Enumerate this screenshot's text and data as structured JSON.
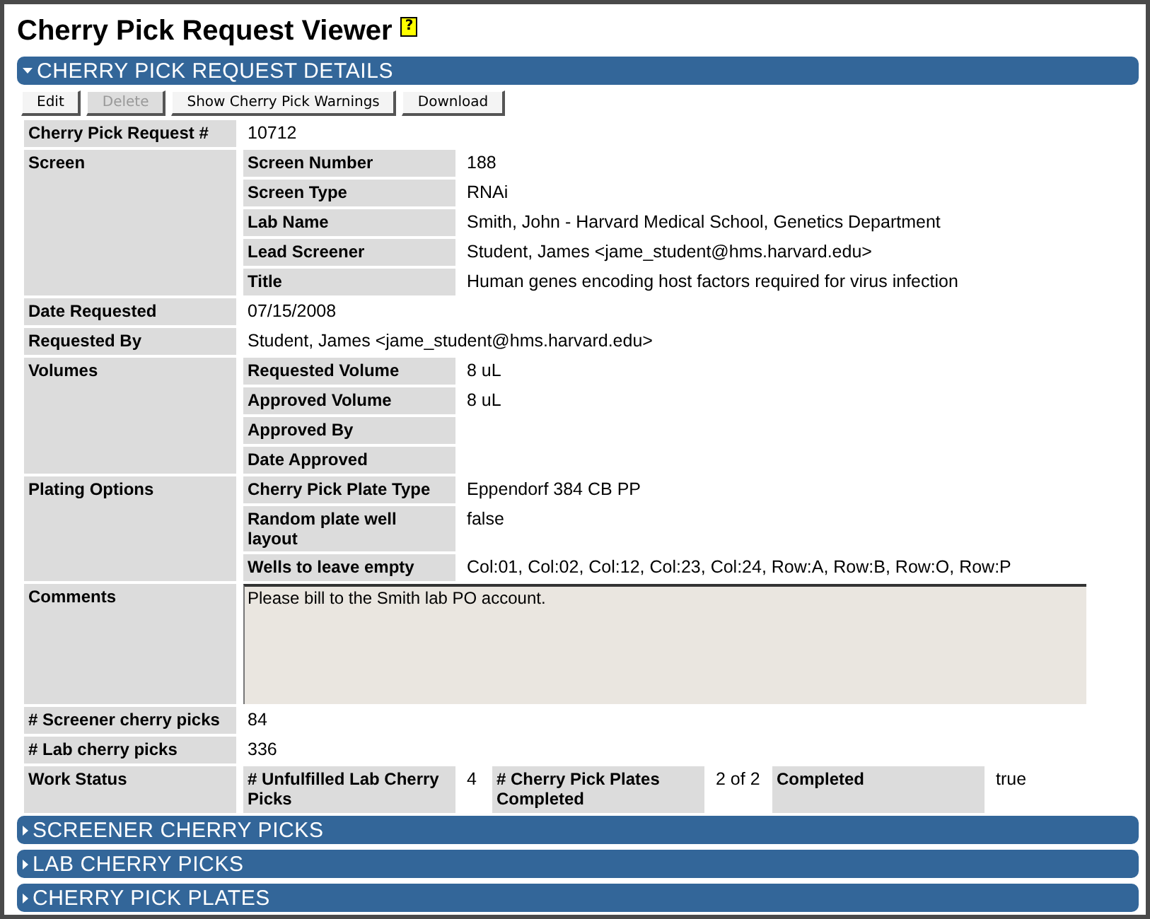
{
  "page": {
    "title": "Cherry Pick Request Viewer",
    "help_icon": "?"
  },
  "sections": [
    {
      "title": "CHERRY PICK REQUEST DETAILS",
      "expanded": true
    },
    {
      "title": "SCREENER CHERRY PICKS",
      "expanded": false
    },
    {
      "title": "LAB CHERRY PICKS",
      "expanded": false
    },
    {
      "title": "CHERRY PICK PLATES",
      "expanded": false
    }
  ],
  "buttons": [
    {
      "label": "Edit",
      "disabled": false
    },
    {
      "label": "Delete",
      "disabled": true
    },
    {
      "label": "Show Cherry Pick Warnings",
      "disabled": false
    },
    {
      "label": "Download",
      "disabled": false
    }
  ],
  "rows": [
    {
      "kind": "text",
      "label": "Cherry Pick Request #",
      "value": "10712"
    },
    {
      "kind": "group",
      "label": "Screen",
      "fields": [
        {
          "label": "Screen Number",
          "value": "188"
        },
        {
          "label": "Screen Type",
          "value": "RNAi"
        },
        {
          "label": "Lab Name",
          "value": "Smith, John - Harvard Medical School, Genetics Department"
        },
        {
          "label": "Lead Screener",
          "value": "Student, James <jame_student@hms.harvard.edu>"
        },
        {
          "label": "Title",
          "value": "Human genes encoding host factors required for virus infection"
        }
      ]
    },
    {
      "kind": "text",
      "label": "Date Requested",
      "value": "07/15/2008"
    },
    {
      "kind": "text",
      "label": "Requested By",
      "value": "Student, James <jame_student@hms.harvard.edu>"
    },
    {
      "kind": "group",
      "label": "Volumes",
      "fields": [
        {
          "label": "Requested Volume",
          "value": "8 uL"
        },
        {
          "label": "Approved Volume",
          "value": "8 uL"
        },
        {
          "label": "Approved By"
        },
        {
          "label": "Date Approved"
        }
      ]
    },
    {
      "kind": "group",
      "label": "Plating Options",
      "fields": [
        {
          "label": "Cherry Pick Plate Type",
          "value": "Eppendorf 384 CB PP"
        },
        {
          "label": "Random plate well layout",
          "value": "false"
        },
        {
          "label": "Wells to leave empty",
          "value": "Col:01, Col:02, Col:12, Col:23, Col:24, Row:A, Row:B, Row:O, Row:P"
        }
      ]
    },
    {
      "kind": "comments",
      "label": "Comments",
      "value": "Please bill to the Smith lab PO account."
    },
    {
      "kind": "text",
      "label": "# Screener cherry picks",
      "value": "84"
    },
    {
      "kind": "text",
      "label": "# Lab cherry picks",
      "value": "336"
    },
    {
      "kind": "inline",
      "label": "Work Status",
      "fields": [
        {
          "label": "# Unfulfilled Lab Cherry Picks",
          "value": "4"
        },
        {
          "label": "# Cherry Pick Plates Completed",
          "value": "2 of 2"
        },
        {
          "label": "Completed",
          "value": "true"
        }
      ]
    }
  ]
}
